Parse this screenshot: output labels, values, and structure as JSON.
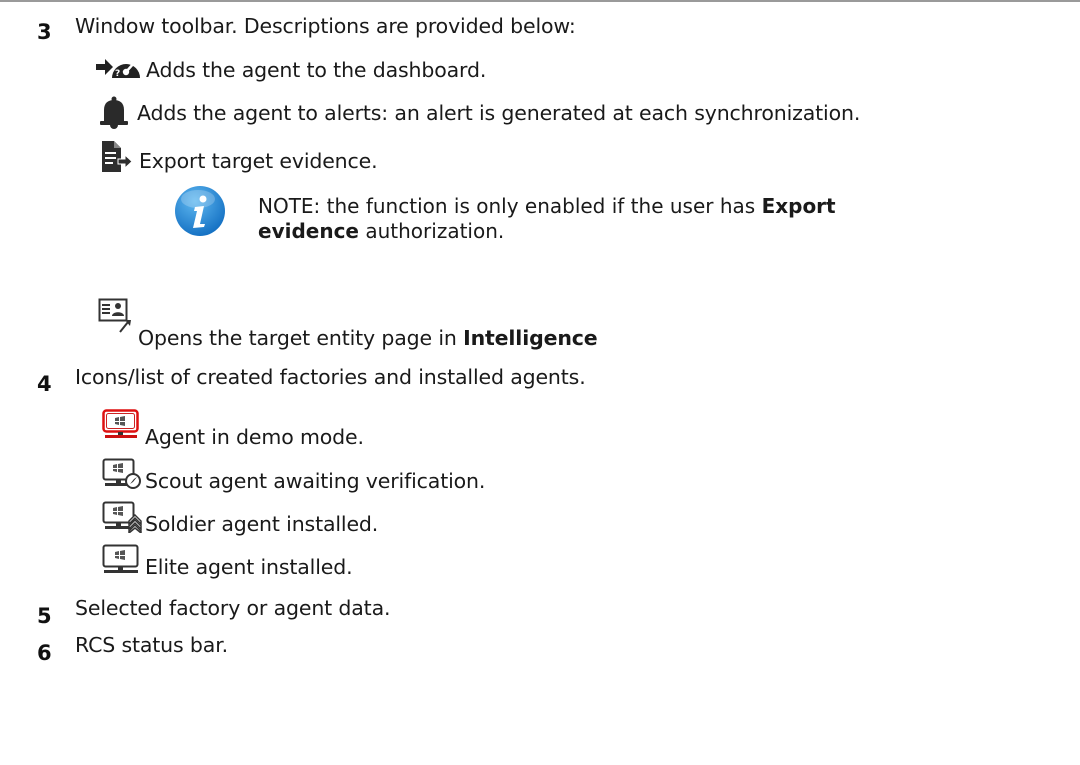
{
  "items": [
    {
      "number": "3",
      "text": "Window toolbar. Descriptions are provided below:",
      "icons": [
        {
          "icon": "dashboard-add-icon",
          "text": "Adds the agent to the dashboard."
        },
        {
          "icon": "bell-alert-icon",
          "text": "Adds the agent to alerts: an alert is generated at each synchronization."
        },
        {
          "icon": "export-evidence-icon",
          "text": "Export target evidence."
        },
        {
          "icon": "target-entity-icon",
          "text_before": "Opens the target entity page in ",
          "text_bold": "Intelligence"
        }
      ],
      "note": {
        "icon": "info-icon",
        "prefix": "NOTE: the function is only enabled if the user has ",
        "bold1": "Export",
        "bold2": "evidence",
        "suffix": " authorization."
      }
    },
    {
      "number": "4",
      "text": "Icons/list of created factories and installed agents.",
      "icons": [
        {
          "icon": "agent-demo-icon",
          "text": "Agent in demo mode."
        },
        {
          "icon": "scout-agent-icon",
          "text": "Scout agent awaiting verification."
        },
        {
          "icon": "soldier-agent-icon",
          "text": "Soldier agent installed."
        },
        {
          "icon": "elite-agent-icon",
          "text": "Elite agent installed."
        }
      ]
    },
    {
      "number": "5",
      "text": "Selected factory or agent data."
    },
    {
      "number": "6",
      "text": "RCS status bar."
    }
  ]
}
